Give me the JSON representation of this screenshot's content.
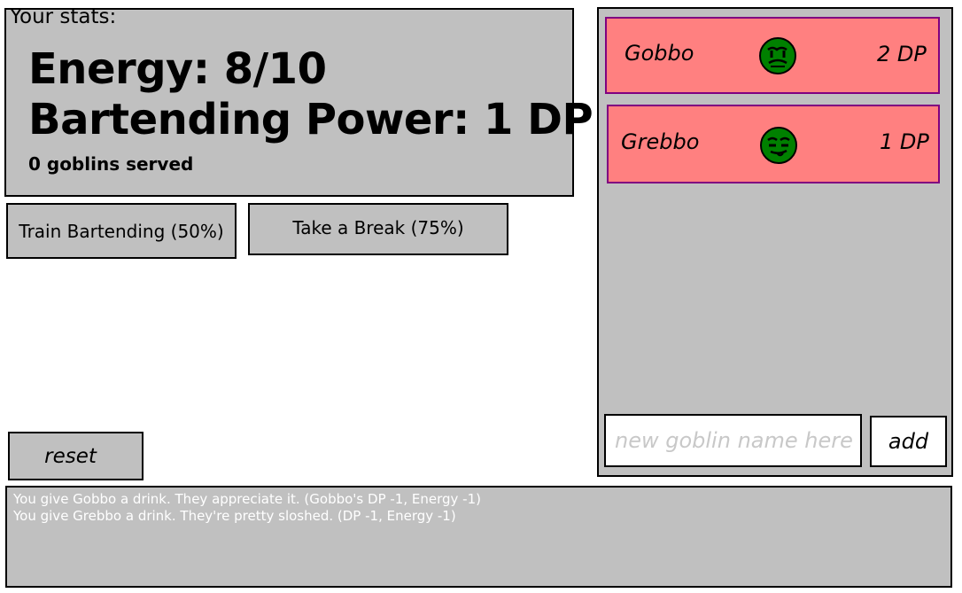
{
  "stats": {
    "heading": "Your stats:",
    "energy": "Energy: 8/10",
    "power": "Bartending Power: 1 DP",
    "served": "0 goblins served"
  },
  "actions": {
    "train_label": "Train Bartending (50%)",
    "break_label": "Take a Break (75%)",
    "reset_label": "reset"
  },
  "goblins": [
    {
      "name": "Gobbo",
      "dp": "2 DP",
      "face_icon": "goblin-face-icon"
    },
    {
      "name": "Grebbo",
      "dp": "1 DP",
      "face_icon": "goblin-face-icon"
    }
  ],
  "new_goblin": {
    "placeholder": "new goblin name here",
    "value": "",
    "add_label": "add"
  },
  "log": [
    "You give Gobbo a drink. They appreciate it. (Gobbo's DP -1, Energy -1)",
    "You give Grebbo a drink. They're pretty sloshed. (DP -1, Energy -1)"
  ],
  "colors": {
    "panel": "#c0c0c0",
    "card": "#ff8080",
    "card_border": "#800080",
    "goblin_skin": "#008000",
    "log_text": "#ffffff"
  }
}
